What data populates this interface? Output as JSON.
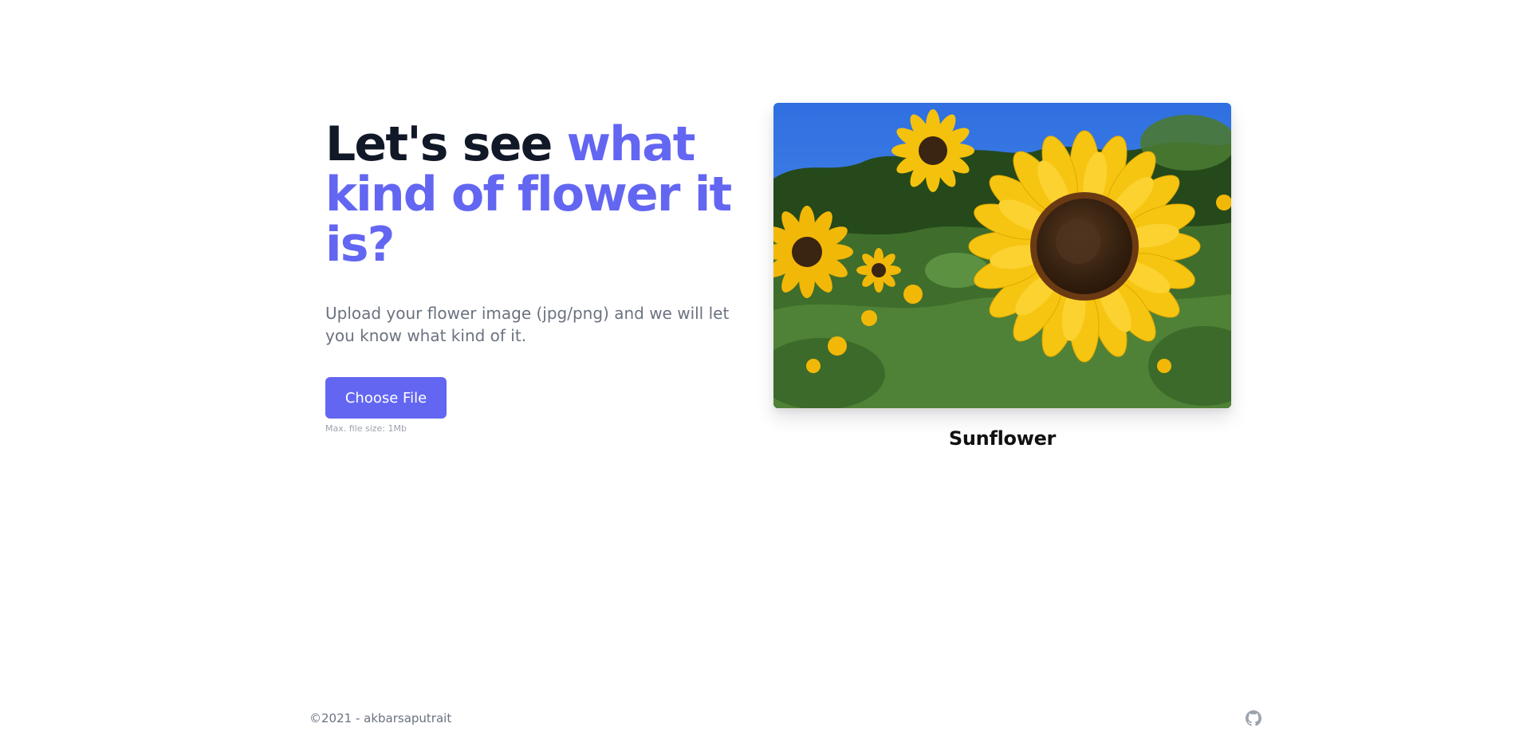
{
  "hero": {
    "headline_part1": "Let's see ",
    "headline_part2": "what kind of flower it is?",
    "description": "Upload your flower image (jpg/png) and we will let you know what kind of it.",
    "upload_button_label": "Choose File",
    "file_size_hint": "Max. file size: 1Mb"
  },
  "result": {
    "image_subject": "sunflower-photo",
    "flower_name": "Sunflower"
  },
  "footer": {
    "copyright": "©2021 - akbarsaputrait",
    "github_icon": "github-icon"
  },
  "colors": {
    "accent": "#6366f1",
    "headline_dark": "#111827",
    "body_text": "#6b7280",
    "hint_text": "#9ca3af"
  }
}
